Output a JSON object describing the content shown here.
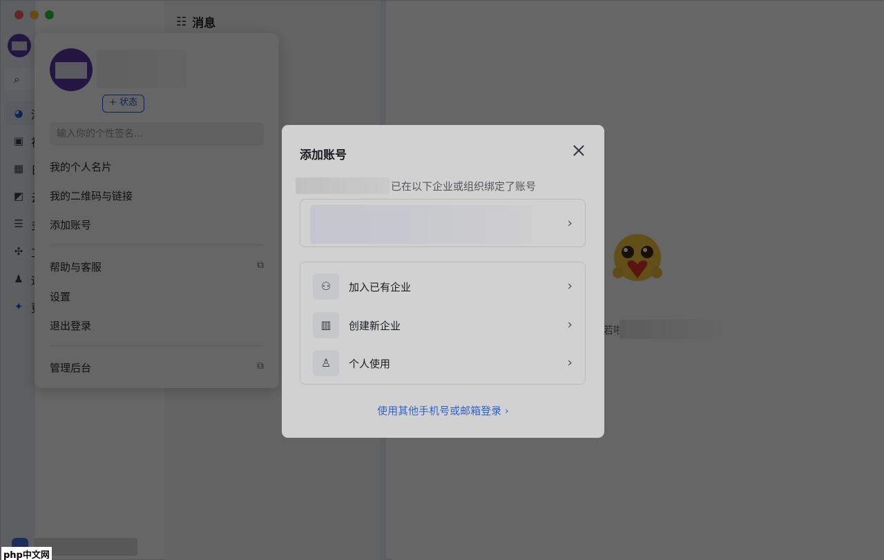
{
  "app": {
    "rail_labels": [
      "消",
      "视",
      "日",
      "云",
      "多",
      "工",
      "通",
      "更"
    ],
    "mid_title": "消息",
    "empty_text": "若啦"
  },
  "profile_popover": {
    "status_button": "+ 状态",
    "signature_placeholder": "输入你的个性签名...",
    "menu": [
      {
        "label": "我的个人名片"
      },
      {
        "label": "我的二维码与链接"
      },
      {
        "label": "添加账号"
      },
      {
        "label": "帮助与客服",
        "external": true
      },
      {
        "label": "设置"
      },
      {
        "label": "退出登录"
      },
      {
        "label": "管理后台",
        "external": true
      }
    ]
  },
  "modal": {
    "title": "添加账号",
    "bound_text": "已在以下企业或组织绑定了账号",
    "options": [
      {
        "label": "加入已有企业",
        "icon": "join-team-icon"
      },
      {
        "label": "创建新企业",
        "icon": "building-icon"
      },
      {
        "label": "个人使用",
        "icon": "person-icon"
      }
    ],
    "other_login": "使用其他手机号或邮箱登录 ›"
  },
  "watermark": "php中文网",
  "colors": {
    "accent": "#245bdb",
    "overlay": "rgba(0,0,0,0.60)"
  }
}
